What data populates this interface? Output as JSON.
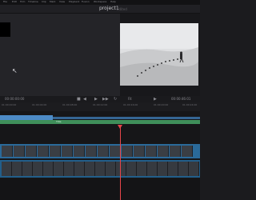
{
  "menu": {
    "items": [
      "File",
      "Edit",
      "Trim",
      "Timeline",
      "Clip",
      "Mark",
      "View",
      "Playback",
      "Fusion",
      "Workspace",
      "Help"
    ]
  },
  "project": {
    "title": "project1",
    "subtitle": "Edited"
  },
  "controls": {
    "zoom": "Fit",
    "fit_viewer": "Fit",
    "timecode_left": "00:00:00:00",
    "timecode_right": "00:00:46:01"
  },
  "ruler": {
    "ticks": [
      "01:00:00:00",
      "01:00:04:00",
      "01:00:08:00",
      "01:00:12:00",
      "01:00:16:00",
      "01:00:20:00",
      "01:00:24:00"
    ]
  },
  "tracks": {
    "green_label": "Title"
  },
  "colors": {
    "accent": "#e8464a",
    "video_track": "#2a6a9a",
    "title_track": "#3f8f5a",
    "blue_clip": "#4d8bc6"
  },
  "icons": [
    "cursor-icon",
    "play-icon",
    "stop-icon",
    "prev-icon",
    "next-icon",
    "loop-icon"
  ]
}
